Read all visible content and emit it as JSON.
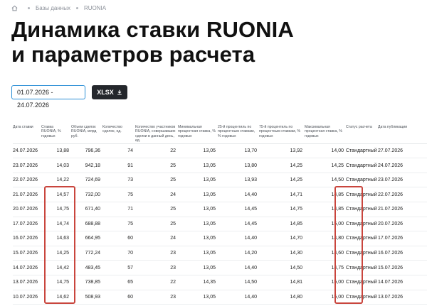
{
  "breadcrumb": {
    "items": [
      "Базы данных",
      "RUONIA"
    ]
  },
  "title": {
    "line1": "Динамика ставки RUONIA",
    "line2": "и параметров расчета"
  },
  "controls": {
    "date_range": "01.07.2026 - 24.07.2026",
    "xlsx_label": "XLSX"
  },
  "table": {
    "headers": [
      "Дата ставки",
      "Ставка RUONIA, % годовых",
      "Объем сделок RUONIA, млрд руб.",
      "Количество сделок, ед.",
      "Количество участников RUONIA, совершавших сделки в данный день, ед.",
      "Минимальная процентная ставка, % годовых",
      "25-й процентиль по процентным ставкам, % годовых",
      "75-й процентиль по процентным ставкам, % годовых",
      "Максимальная процентная ставка, % годовых",
      "Статус расчета",
      "Дата публикации"
    ],
    "rows": [
      [
        "24.07.2026",
        "13,88",
        "796,36",
        "74",
        "22",
        "13,05",
        "13,70",
        "13,92",
        "14,00",
        "Стандартный",
        "27.07.2026"
      ],
      [
        "23.07.2026",
        "14,03",
        "942,18",
        "91",
        "25",
        "13,05",
        "13,80",
        "14,25",
        "14,25",
        "Стандартный",
        "24.07.2026"
      ],
      [
        "22.07.2026",
        "14,22",
        "724,69",
        "73",
        "25",
        "13,05",
        "13,93",
        "14,25",
        "14,50",
        "Стандартный",
        "23.07.2026"
      ],
      [
        "21.07.2026",
        "14,57",
        "732,00",
        "75",
        "24",
        "13,05",
        "14,40",
        "14,71",
        "14,85",
        "Стандартный",
        "22.07.2026"
      ],
      [
        "20.07.2026",
        "14,75",
        "671,40",
        "71",
        "25",
        "13,05",
        "14,45",
        "14,75",
        "14,85",
        "Стандартный",
        "21.07.2026"
      ],
      [
        "17.07.2026",
        "14,74",
        "688,88",
        "75",
        "25",
        "13,05",
        "14,45",
        "14,85",
        "15,00",
        "Стандартный",
        "20.07.2026"
      ],
      [
        "16.07.2026",
        "14,63",
        "664,95",
        "60",
        "24",
        "13,05",
        "14,40",
        "14,70",
        "14,80",
        "Стандартный",
        "17.07.2026"
      ],
      [
        "15.07.2026",
        "14,25",
        "772,24",
        "70",
        "23",
        "13,05",
        "14,20",
        "14,30",
        "14,60",
        "Стандартный",
        "16.07.2026"
      ],
      [
        "14.07.2026",
        "14,42",
        "483,45",
        "57",
        "23",
        "13,05",
        "14,40",
        "14,50",
        "14,75",
        "Стандартный",
        "15.07.2026"
      ],
      [
        "13.07.2026",
        "14,75",
        "738,85",
        "65",
        "22",
        "14,35",
        "14,50",
        "14,81",
        "15,00",
        "Стандартный",
        "14.07.2026"
      ],
      [
        "10.07.2026",
        "14,62",
        "508,93",
        "60",
        "23",
        "13,05",
        "14,40",
        "14,80",
        "15,00",
        "Стандартный",
        "13.07.2026"
      ]
    ]
  },
  "icons": {
    "home": "home-icon",
    "download": "download-icon"
  },
  "colors": {
    "accent_border": "#2b8fd6",
    "button_bg": "#24272c",
    "highlight": "#c9453d"
  }
}
